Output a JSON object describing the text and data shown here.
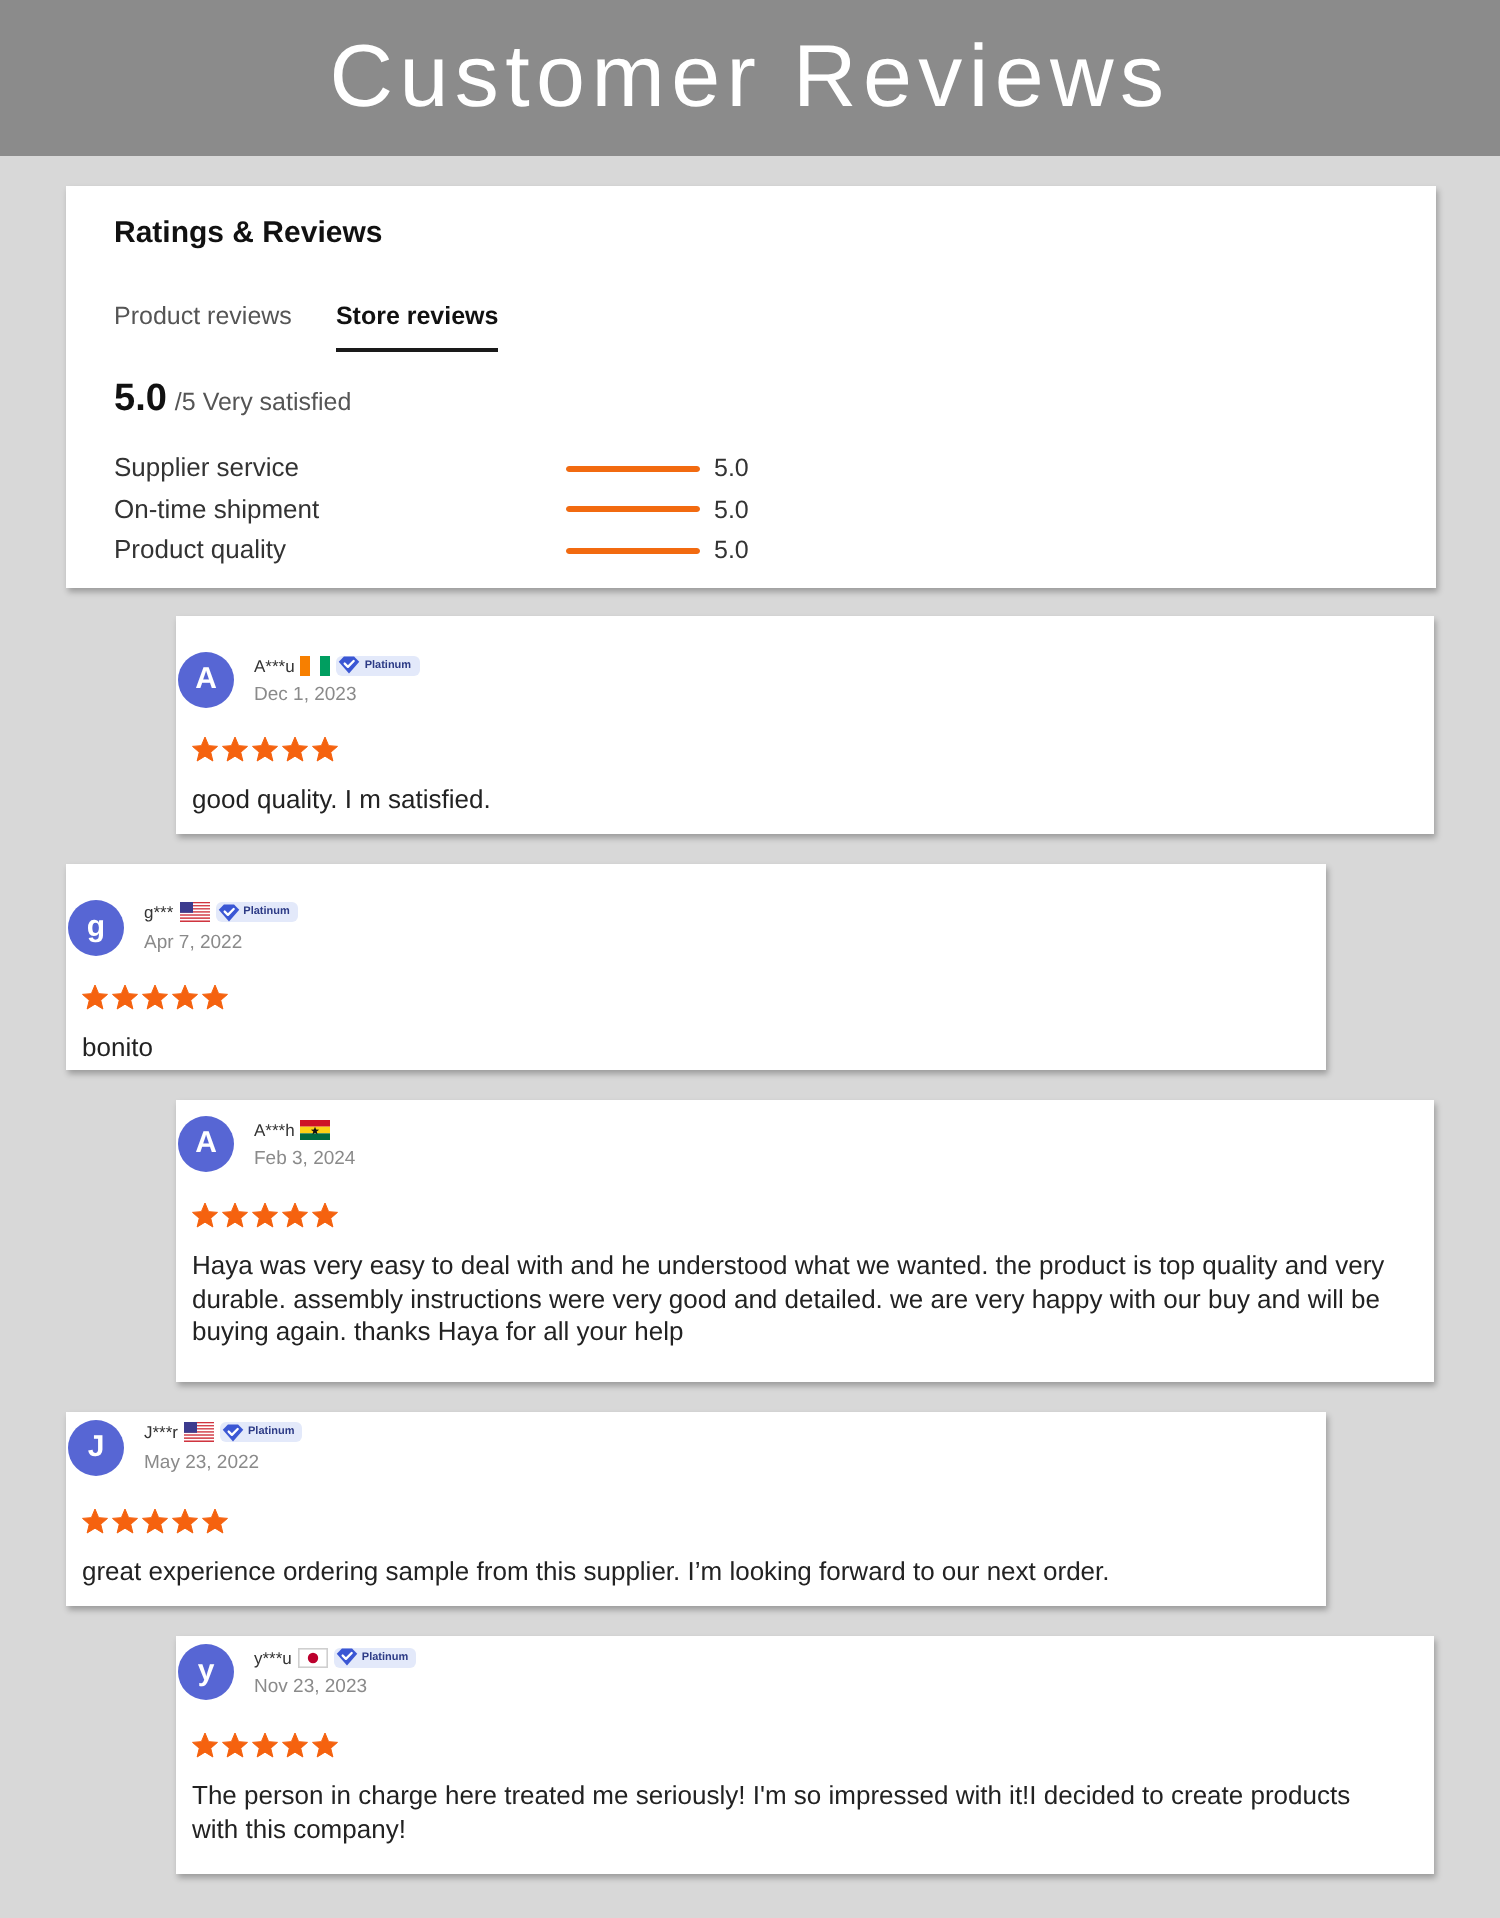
{
  "header": {
    "title": "Customer Reviews"
  },
  "summary": {
    "title": "Ratings & Reviews",
    "tabs": [
      {
        "label": "Product reviews",
        "selected": false
      },
      {
        "label": "Store reviews",
        "selected": true
      }
    ],
    "score": "5.0",
    "score_suffix": "/5 Very satisfied",
    "ratings": [
      {
        "label": "Supplier service",
        "level": 1,
        "reading": "5.0"
      },
      {
        "label": "On-time shipment",
        "level": 1,
        "reading": "5.0"
      },
      {
        "label": "Product quality",
        "level": 1,
        "reading": "5.0"
      }
    ]
  },
  "reviews": [
    {
      "initial": "A",
      "name": "A***u",
      "flag": {
        "kind": "ci"
      },
      "badge": "Platinum",
      "date": "Dec 1, 2023",
      "stars": 5,
      "text": "good quality. I m satisfied."
    },
    {
      "initial": "g",
      "name": "g***",
      "flag": {
        "kind": "us"
      },
      "badge": "Platinum",
      "date": "Apr 7, 2022",
      "stars": 5,
      "text": "bonito"
    },
    {
      "initial": "A",
      "name": "A***h",
      "flag": {
        "kind": "gh"
      },
      "date": "Feb 3, 2024",
      "stars": 5,
      "text": "Haya was very easy to deal with and he understood what we wanted. the product is top quality and very durable. assembly instructions were very good and detailed. we are very happy with our buy and will be buying again. thanks Haya for all your help"
    },
    {
      "initial": "J",
      "name": "J***r",
      "flag": {
        "kind": "us"
      },
      "badge": "Platinum",
      "date": "May 23, 2022",
      "stars": 5,
      "text": "great experience ordering sample from this supplier. I’m looking forward to our next order."
    },
    {
      "initial": "y",
      "name": "y***u",
      "flag": {
        "kind": "jp"
      },
      "badge": "Platinum",
      "date": "Nov 23, 2023",
      "stars": 5,
      "text": "The person in charge here treated me seriously! I'm so impressed with it!I decided to create products with this company!"
    }
  ]
}
